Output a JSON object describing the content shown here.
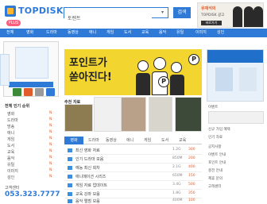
{
  "brand": {
    "logo_text": "TOPDISK",
    "badge": "PLUS"
  },
  "search": {
    "value": "토렌트",
    "button_label": "검색"
  },
  "top_banner": {
    "title": "유재석의",
    "subtitle": "TOPDISK 광고",
    "cta": "바로가기"
  },
  "nav": {
    "items": [
      "전체",
      "영화",
      "드라마",
      "동영상",
      "애니",
      "게임",
      "도서",
      "교육",
      "음악",
      "유틸",
      "이미지",
      "성인"
    ]
  },
  "sidebar": {
    "category_header": "전체 인기 순위",
    "categories": [
      {
        "label": "영화",
        "count": "N"
      },
      {
        "label": "드라마",
        "count": "N"
      },
      {
        "label": "방송",
        "count": "N"
      },
      {
        "label": "애니",
        "count": "N"
      },
      {
        "label": "게임",
        "count": "N"
      },
      {
        "label": "도서",
        "count": "N"
      },
      {
        "label": "교육",
        "count": "N"
      },
      {
        "label": "음악",
        "count": "N"
      },
      {
        "label": "유틸",
        "count": "N"
      },
      {
        "label": "이미지",
        "count": "N"
      },
      {
        "label": "성인",
        "count": "N"
      }
    ],
    "cs_label": "고객센터",
    "cs_phone": "053.323.7777"
  },
  "main_banner": {
    "line1": "포인트가",
    "line2": "쏟아진다!",
    "coin_letter": "P"
  },
  "content": {
    "section_label": "추천 자료",
    "tabs": [
      "영화",
      "드라마",
      "동영상",
      "애니",
      "게임",
      "도서",
      "교육"
    ],
    "rows": [
      {
        "title": "최신 영화 자료",
        "size": "1.2G",
        "price": "300"
      },
      {
        "title": "인기 드라마 모음",
        "size": "850M",
        "price": "200"
      },
      {
        "title": "예능 최신 회차",
        "size": "2.1G",
        "price": "400"
      },
      {
        "title": "애니메이션 시리즈",
        "size": "650M",
        "price": "150"
      },
      {
        "title": "게임 자료 업데이트",
        "size": "3.4G",
        "price": "500"
      },
      {
        "title": "교육 강좌 모음",
        "size": "1.8G",
        "price": "350"
      },
      {
        "title": "음악 앨범 모음",
        "size": "400M",
        "price": "100"
      }
    ]
  },
  "right": {
    "captions": [
      "이벤트",
      "신규 가입 혜택",
      "인기 자료"
    ],
    "list": [
      "공지사항",
      "이벤트 안내",
      "포인트 안내",
      "충전 안내",
      "제휴 문의",
      "고객센터"
    ]
  },
  "colors": {
    "brand_blue": "#2f7ad7",
    "banner_yellow": "#f3d530",
    "accent": "#e25c2b"
  }
}
